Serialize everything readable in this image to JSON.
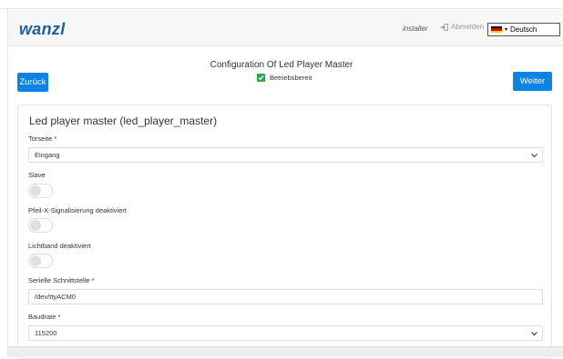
{
  "header": {
    "logo": "wanzl",
    "user": "installer",
    "logout_label": "Abmelden",
    "language": "Deutsch"
  },
  "page": {
    "title": "Configuration Of Led Player Master",
    "status": "Betriebsbereit",
    "back_label": "Zurück",
    "next_label": "Weiter"
  },
  "form": {
    "card_title": "Led player master (led_player_master)",
    "torseite_label": "Torseite *",
    "torseite_value": "Eingang",
    "slave_label": "Slave",
    "slave_on": false,
    "pfeil_label": "Pfeil-X-Signalisierung deaktiviert",
    "pfeil_on": false,
    "lichtband_label": "Lichtband deaktiviert",
    "lichtband_on": false,
    "serial_label": "Serielle Schnittstelle *",
    "serial_value": "/dev/ttyACM0",
    "baud_label": "Baudrate *",
    "baud_value": "115200"
  },
  "colors": {
    "primary": "#0b84e5",
    "logo": "#1f5fa8",
    "success": "#2ea84a"
  }
}
